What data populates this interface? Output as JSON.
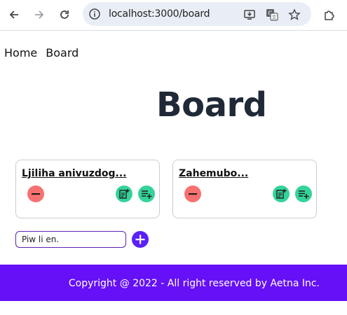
{
  "browser": {
    "url": "localhost:3000/board",
    "icons": [
      "back-arrow-icon",
      "forward-arrow-icon",
      "reload-icon",
      "site-info-icon",
      "install-app-icon",
      "translate-icon",
      "bookmark-star-icon",
      "extensions-icon"
    ]
  },
  "nav": {
    "home": "Home",
    "board": "Board"
  },
  "page": {
    "title": "Board"
  },
  "cards": [
    {
      "name": "Ljiliha anivuzdog..."
    },
    {
      "name": "Zahemubo..."
    }
  ],
  "add": {
    "value": "Piw li en."
  },
  "footer": {
    "text": "Copyright @ 2022 - All right reserved by Aetna Inc."
  },
  "colors": {
    "accent": "#6510f7",
    "remove": "#f87171",
    "action": "#34d399",
    "title": "#1f2937"
  }
}
